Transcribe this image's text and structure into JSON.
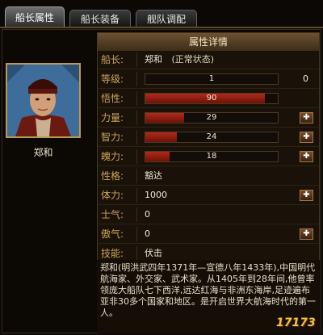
{
  "tabs": [
    {
      "label": "船长属性",
      "active": true
    },
    {
      "label": "船长装备",
      "active": false
    },
    {
      "label": "舰队调配",
      "active": false
    }
  ],
  "captain": {
    "name_label": "郑和",
    "portrait_icon": "captain-portrait"
  },
  "panel": {
    "title": "属性详情",
    "captain_row": {
      "label": "船长:",
      "name": "郑和",
      "status": "(正常状态)"
    },
    "level": {
      "label": "等级:",
      "value": "1",
      "max": "0",
      "fill": 0
    },
    "morale": {
      "label": "悟性:",
      "value": "90",
      "fill": 0.9
    },
    "strength": {
      "label": "力量:",
      "value": "29",
      "fill": 0.29
    },
    "intellect": {
      "label": "智力:",
      "value": "24",
      "fill": 0.24
    },
    "charisma": {
      "label": "魄力:",
      "value": "18",
      "fill": 0.18
    },
    "personality": {
      "label": "性格:",
      "value": "豁达"
    },
    "stamina": {
      "label": "体力:",
      "value": "1000"
    },
    "morale2": {
      "label": "士气:",
      "value": "0"
    },
    "pride": {
      "label": "傲气:",
      "value": "0"
    },
    "skill": {
      "label": "技能:",
      "value": "伏击"
    }
  },
  "description": "郑和(明洪武四年1371年—宣德八年1433年),中国明代航海家、外交家、武术家。从1405年到28年间,他曾率领庞大船队七下西洋,远达红海与非洲东海岸,足迹遍布亚非30多个国家和地区。是开启世界大航海时代的第一人。",
  "watermark": "17173",
  "colors": {
    "accent": "#c9a45a",
    "bar_fill": "#b12a1a",
    "panel_header": "#6a5232"
  }
}
